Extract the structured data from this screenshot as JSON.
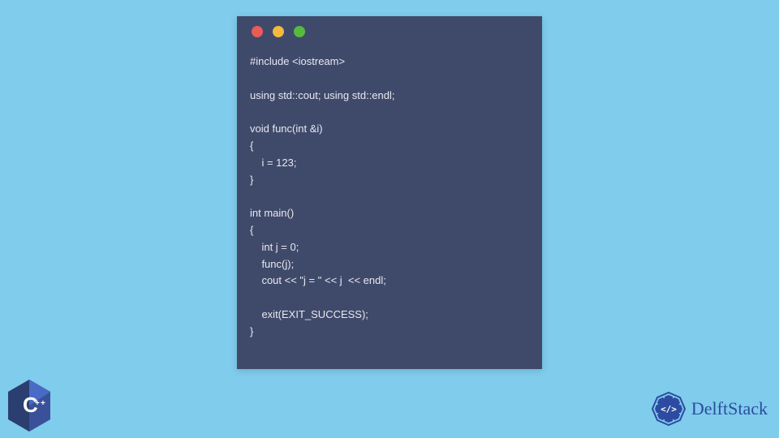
{
  "code_window": {
    "traffic_lights": [
      "red",
      "yellow",
      "green"
    ],
    "code": "#include <iostream>\n\nusing std::cout; using std::endl;\n\nvoid func(int &i)\n{\n    i = 123;\n}\n\nint main()\n{\n    int j = 0;\n    func(j);\n    cout << \"j = \" << j  << endl;\n\n    exit(EXIT_SUCCESS);\n}"
  },
  "cpp_logo": {
    "label": "C++",
    "text": "C",
    "plus": "++"
  },
  "delft_logo": {
    "text": "DelftStack",
    "badge_symbol": "</>"
  }
}
